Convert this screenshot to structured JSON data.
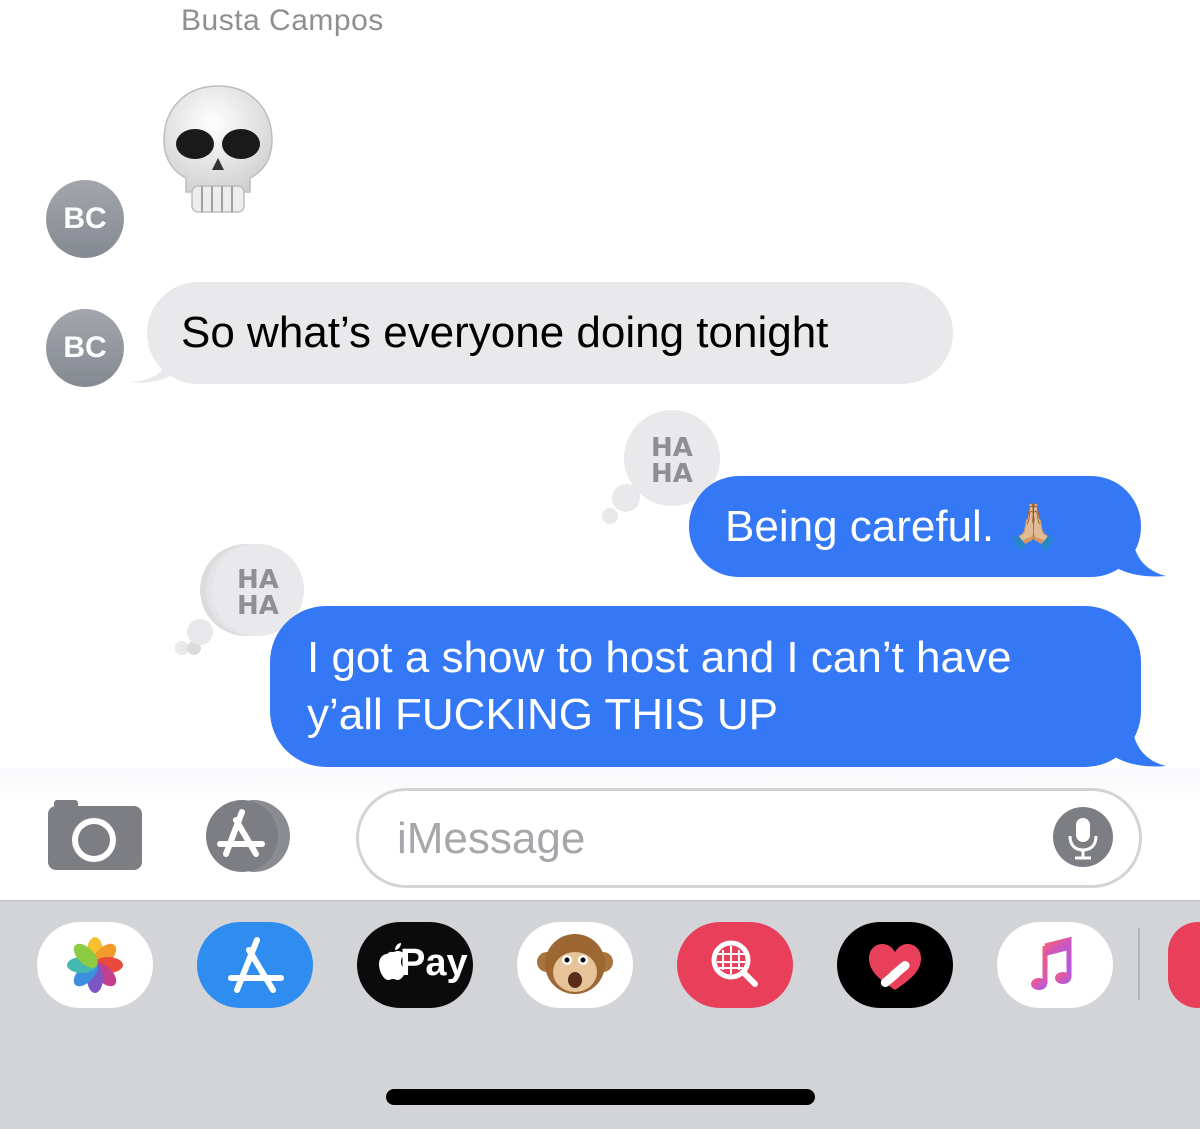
{
  "conversation": {
    "sender_name": "Busta Campos",
    "sender_initials": "BC",
    "messages": [
      {
        "from": "incoming",
        "kind": "emoji",
        "icon": "skull-emoji"
      },
      {
        "from": "incoming",
        "kind": "text",
        "text": "So what’s everyone doing tonight"
      },
      {
        "from": "outgoing",
        "kind": "text",
        "text": "Being careful. 🙏🏼",
        "tapback": "HA HA"
      },
      {
        "from": "outgoing",
        "kind": "text",
        "lines": [
          "I got a show to host and I can’t have",
          "y’all FUCKING THIS UP"
        ],
        "tapback": "HA HA"
      }
    ],
    "tapback_label": [
      "HA",
      "HA"
    ]
  },
  "composer": {
    "camera_icon": "camera-icon",
    "apps_icon": "app-store-icon",
    "placeholder": "iMessage",
    "mic_icon": "microphone-icon"
  },
  "app_drawer": {
    "apps": [
      {
        "name": "Photos",
        "icon": "photos-icon"
      },
      {
        "name": "App Store",
        "icon": "app-store-icon"
      },
      {
        "name": "Apple Pay",
        "icon": "apple-pay-icon",
        "label": "Pay"
      },
      {
        "name": "Animoji",
        "icon": "monkey-animoji-icon"
      },
      {
        "name": "Images",
        "icon": "image-search-icon"
      },
      {
        "name": "Digital Touch",
        "icon": "digital-touch-icon"
      },
      {
        "name": "Music",
        "icon": "music-icon"
      }
    ]
  },
  "colors": {
    "outgoing_bubble": "#3478f6",
    "incoming_bubble": "#e9e9eb",
    "avatar": "#8e9199",
    "drawer_background": "#d2d4d8"
  }
}
